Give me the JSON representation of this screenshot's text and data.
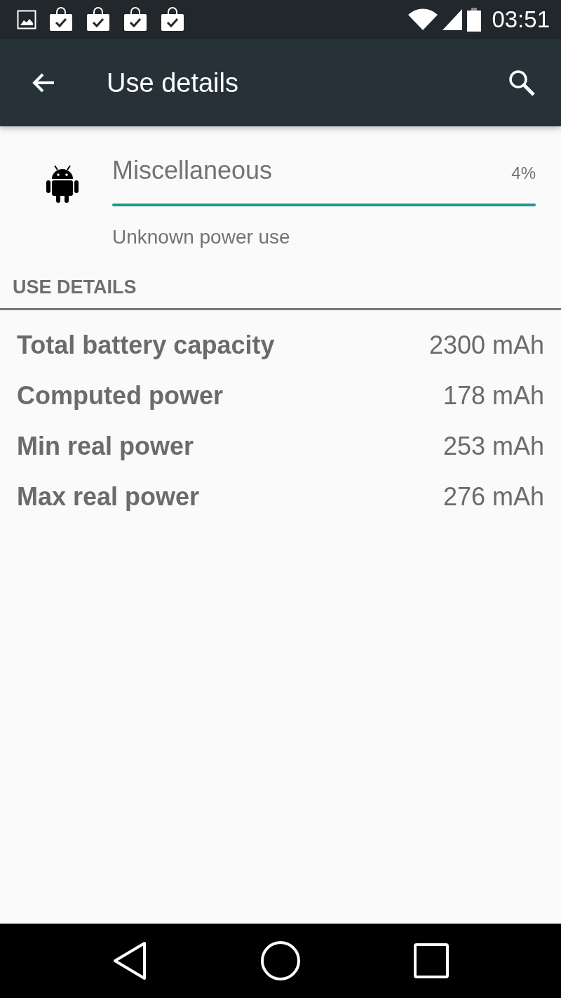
{
  "status_bar": {
    "notifications": [
      {
        "kind": "image"
      },
      {
        "kind": "bag"
      },
      {
        "kind": "bag"
      },
      {
        "kind": "bag"
      },
      {
        "kind": "bag"
      }
    ],
    "time": "03:51"
  },
  "app_bar": {
    "title": "Use details"
  },
  "app": {
    "name": "Miscellaneous",
    "percent": "4%",
    "level": 1,
    "summary": "Unknown power use"
  },
  "section": {
    "title": "USE DETAILS"
  },
  "details": [
    {
      "label": "Total battery capacity",
      "value": "2300 mAh"
    },
    {
      "label": "Computed power",
      "value": "178 mAh"
    },
    {
      "label": "Min real power",
      "value": "253 mAh"
    },
    {
      "label": "Max real power",
      "value": "276 mAh"
    }
  ]
}
